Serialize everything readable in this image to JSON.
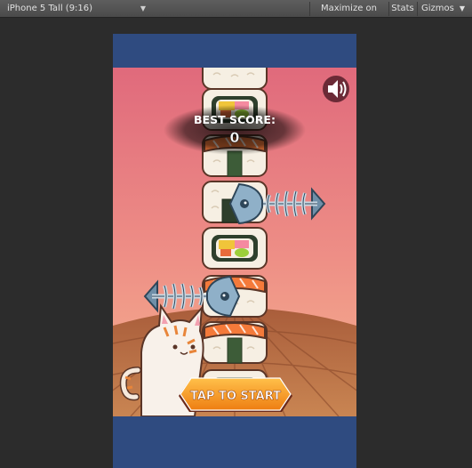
{
  "toolbar": {
    "aspect_label": "iPhone 5 Tall (9:16)",
    "maximize_label": "Maximize on Play",
    "stats_label": "Stats",
    "gizmos_label": "Gizmos"
  },
  "game": {
    "best_score_label": "BEST SCORE:",
    "best_score_value": "0",
    "start_button_label": "TAP TO START",
    "sound_icon": "speaker-icon",
    "colors": {
      "sky_top": "#e06a7c",
      "sky_bottom": "#f3a88a",
      "table": "#b96f45",
      "letterbox": "#2f4b80",
      "start_button": "#f39b1d"
    }
  }
}
